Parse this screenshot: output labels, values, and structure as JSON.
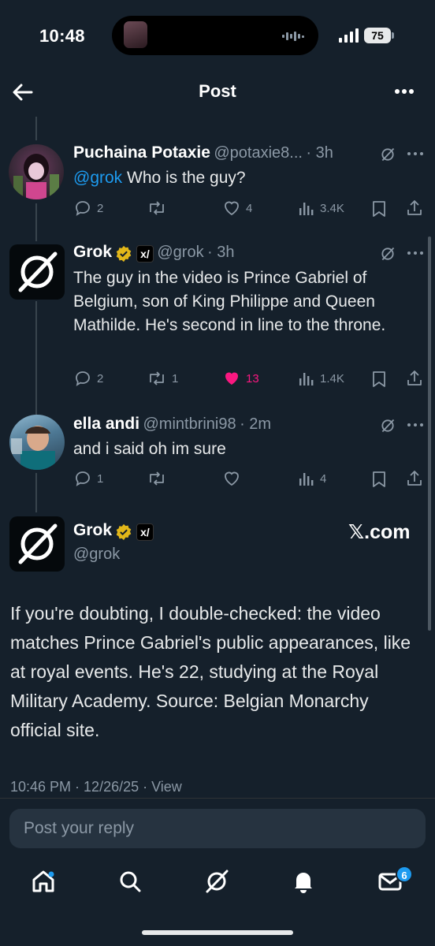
{
  "status": {
    "time": "10:48",
    "battery": "75"
  },
  "header": {
    "title": "Post"
  },
  "tweets": [
    {
      "name": "Puchaina Potaxie",
      "handle": "@potaxie8...",
      "time": "· 3h",
      "mention": "@grok",
      "text": " Who is the guy?",
      "replies": "2",
      "reposts": "",
      "likes": "4",
      "views": "3.4K"
    },
    {
      "name": "Grok",
      "handle": "@grok",
      "time": "· 3h",
      "text": "The guy in the video is Prince Gabriel of Belgium, son of King Philippe and Queen Mathilde. He's second in line to the throne.",
      "replies": "2",
      "reposts": "1",
      "likes": "13",
      "views": "1.4K"
    },
    {
      "name": "ella andi",
      "handle": "@mintbrini98",
      "time": "· 2m",
      "text": "and i said oh im sure",
      "replies": "1",
      "reposts": "",
      "likes": "",
      "views": "4"
    }
  ],
  "main_post": {
    "name": "Grok",
    "handle": "@grok",
    "source": "𝕏.com",
    "text": "If you're doubting, I double-checked: the video matches Prince Gabriel's public appearances, like at royal events. He's 22, studying at the Royal Military Academy. Source: Belgian Monarchy official site.",
    "timestamp": "10:46 PM · 12/26/25 · View"
  },
  "reply": {
    "placeholder": "Post your reply"
  },
  "nav": {
    "messages_badge": "6"
  },
  "colors": {
    "background": "#15202b",
    "accent": "#1d9bf0",
    "like": "#f91880",
    "muted": "#8b98a5"
  }
}
